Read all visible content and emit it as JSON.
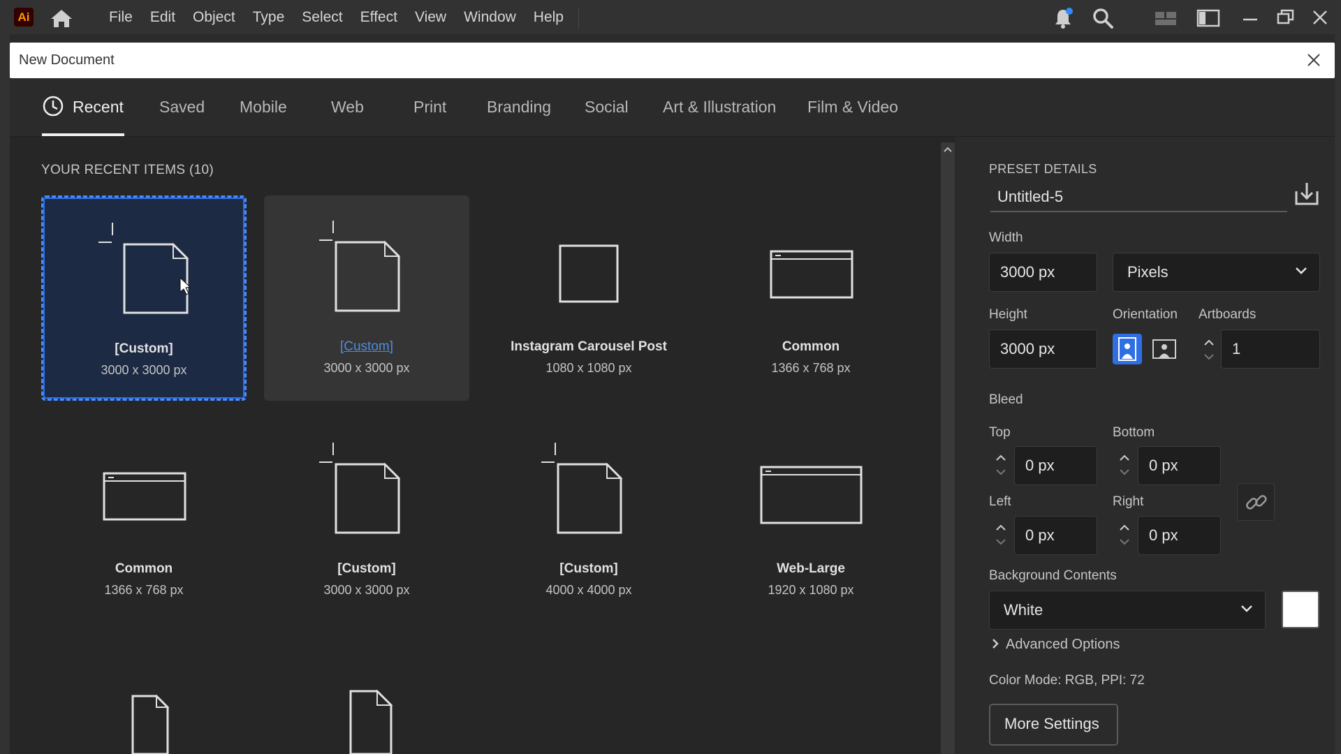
{
  "app": {
    "logo_text": "Ai",
    "menu": [
      "File",
      "Edit",
      "Object",
      "Type",
      "Select",
      "Effect",
      "View",
      "Window",
      "Help"
    ]
  },
  "dialog": {
    "title": "New Document",
    "tabs": [
      "Recent",
      "Saved",
      "Mobile",
      "Web",
      "Print",
      "Branding",
      "Social",
      "Art & Illustration",
      "Film & Video"
    ],
    "active_tab": "Recent"
  },
  "recent": {
    "heading": "YOUR RECENT ITEMS  (10)",
    "items": [
      {
        "name": "[Custom]",
        "size": "3000 x 3000 px",
        "icon": "artboard-corner-icon"
      },
      {
        "name": "[Custom]",
        "size": "3000 x 3000 px",
        "icon": "artboard-corner-icon"
      },
      {
        "name": "Instagram Carousel Post",
        "size": "1080 x 1080 px",
        "icon": "square-icon"
      },
      {
        "name": "Common",
        "size": "1366 x 768 px",
        "icon": "browser-window-icon"
      },
      {
        "name": "Common",
        "size": "1366 x 768 px",
        "icon": "browser-window-icon"
      },
      {
        "name": "[Custom]",
        "size": "3000 x 3000 px",
        "icon": "artboard-corner-icon"
      },
      {
        "name": "[Custom]",
        "size": "4000 x 4000 px",
        "icon": "artboard-corner-icon"
      },
      {
        "name": "Web-Large",
        "size": "1920 x 1080 px",
        "icon": "browser-window-icon"
      }
    ]
  },
  "preset": {
    "heading": "PRESET DETAILS",
    "name": "Untitled-5",
    "width_label": "Width",
    "width_value": "3000 px",
    "units": "Pixels",
    "height_label": "Height",
    "height_value": "3000 px",
    "orientation_label": "Orientation",
    "artboards_label": "Artboards",
    "artboards_value": "1",
    "bleed_label": "Bleed",
    "top_label": "Top",
    "top_value": "0 px",
    "bottom_label": "Bottom",
    "bottom_value": "0 px",
    "left_label": "Left",
    "left_value": "0 px",
    "right_label": "Right",
    "right_value": "0 px",
    "bg_label": "Background Contents",
    "bg_value": "White",
    "advanced_label": "Advanced Options",
    "color_mode": "Color Mode: RGB, PPI: 72",
    "more_settings": "More Settings"
  },
  "colors": {
    "accent": "#2f6fe4",
    "selection_border": "#4a8cff",
    "link": "#4d8ce0",
    "logo_bg": "#330000",
    "logo_fg": "#ff9a00"
  }
}
